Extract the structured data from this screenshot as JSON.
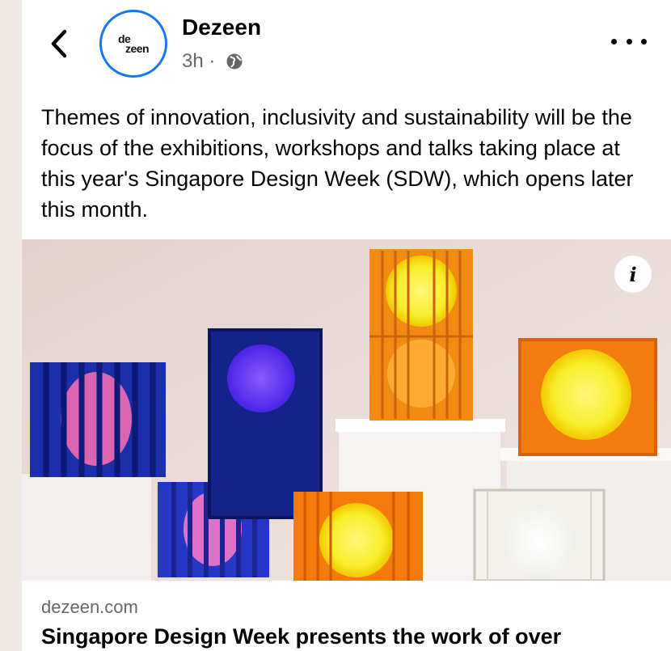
{
  "post": {
    "page_name": "Dezeen",
    "time": "3h",
    "separator": " · ",
    "avatar_logo": {
      "line1": "de",
      "line2": "zeen"
    },
    "text": "Themes of innovation, inclusivity and sustainability will be the focus of the exhibitions, workshops and talks taking place at this year's Singapore Design Week (SDW), which opens later this month.",
    "icons": {
      "back": "chevron-left-icon",
      "more": "more-horizontal-icon",
      "privacy": "globe-icon",
      "info": "info-icon"
    },
    "info_label": "i"
  },
  "link_preview": {
    "domain": "dezeen.com",
    "title": "Singapore Design Week presents the work of over"
  },
  "colors": {
    "accent": "#1877f2",
    "secondary_text": "#65676b",
    "background": "#efebe4"
  }
}
